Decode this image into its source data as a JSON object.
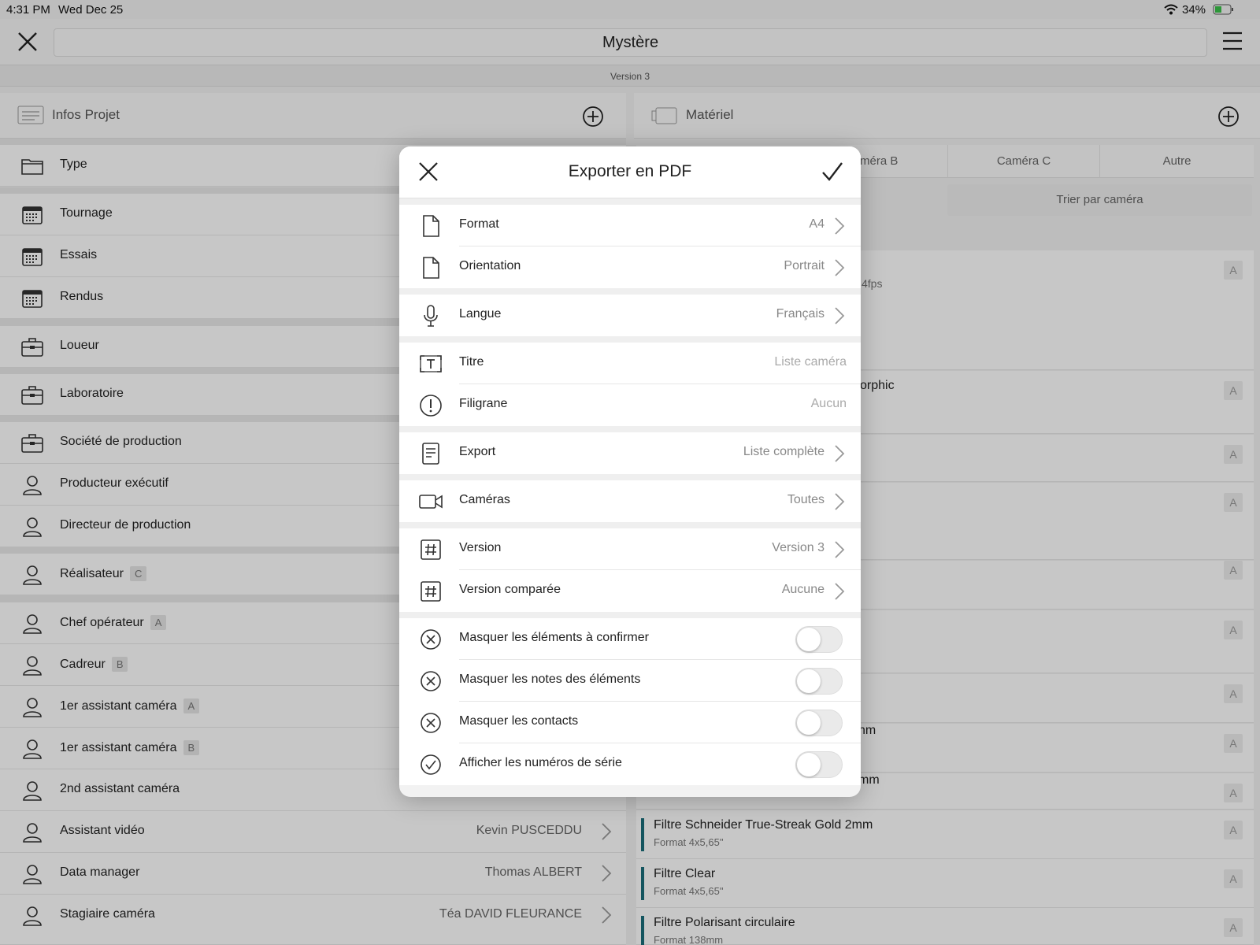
{
  "status_bar": {
    "time": "4:31 PM",
    "date": "Wed Dec 25",
    "battery": "34%"
  },
  "header": {
    "title": "Mystère",
    "version": "Version 3"
  },
  "left_panel": {
    "title": "Infos Projet",
    "rows": [
      {
        "label": "Type",
        "icon": "folder-icon"
      },
      {
        "label": "Tournage",
        "icon": "calendar-icon"
      },
      {
        "label": "Essais",
        "icon": "calendar-icon"
      },
      {
        "label": "Rendus",
        "icon": "calendar-icon"
      },
      {
        "label": "Loueur",
        "icon": "briefcase-icon"
      },
      {
        "label": "Laboratoire",
        "icon": "briefcase-icon"
      },
      {
        "label": "Société de production",
        "icon": "briefcase-icon"
      },
      {
        "label": "Producteur exécutif",
        "icon": "person-icon"
      },
      {
        "label": "Directeur de production",
        "icon": "person-icon"
      },
      {
        "label": "Réalisateur",
        "badge": "C",
        "icon": "person-icon"
      },
      {
        "label": "Chef opérateur",
        "badge": "A",
        "icon": "person-icon"
      },
      {
        "label": "Cadreur",
        "badge": "B",
        "icon": "person-icon"
      },
      {
        "label": "1er assistant caméra",
        "badge": "A",
        "icon": "person-icon"
      },
      {
        "label": "1er assistant caméra",
        "badge": "B",
        "icon": "person-icon"
      },
      {
        "label": "2nd assistant caméra",
        "icon": "person-icon"
      },
      {
        "label": "Assistant vidéo",
        "value": "Kevin PUSCEDDU",
        "icon": "person-icon"
      },
      {
        "label": "Data manager",
        "value": "Thomas ALBERT",
        "icon": "person-icon"
      },
      {
        "label": "Stagiaire caméra",
        "value": "Téa DAVID FLEURANCE",
        "icon": "person-icon"
      }
    ]
  },
  "right_panel": {
    "title": "Matériel",
    "tabs": [
      "méra B",
      "Caméra C",
      "Autre"
    ],
    "sort_button": "Trier par caméra",
    "partial_texts": [
      "4fps",
      "orphic",
      "nm",
      "mm"
    ],
    "badge": "A",
    "items": [
      {
        "title": "Filtre Schneider True-Streak Gold 2mm",
        "subtitle": "Format 4x5,65\""
      },
      {
        "title": "Filtre Clear",
        "subtitle": "Format 4x5,65\""
      },
      {
        "title": "Filtre Polarisant circulaire",
        "subtitle": "Format 138mm"
      }
    ]
  },
  "modal": {
    "title": "Exporter en PDF",
    "rows": [
      {
        "label": "Format",
        "value": "A4",
        "icon": "document-icon"
      },
      {
        "label": "Orientation",
        "value": "Portrait",
        "icon": "document-icon"
      },
      {
        "label": "Langue",
        "value": "Français",
        "icon": "microphone-icon"
      },
      {
        "label": "Titre",
        "placeholder": "Liste caméra",
        "icon": "text-box-icon"
      },
      {
        "label": "Filigrane",
        "placeholder": "Aucun",
        "icon": "exclamation-circle-icon"
      },
      {
        "label": "Export",
        "value": "Liste complète",
        "icon": "list-document-icon"
      },
      {
        "label": "Caméras",
        "value": "Toutes",
        "icon": "video-camera-icon"
      },
      {
        "label": "Version",
        "value": "Version 3",
        "icon": "hash-icon"
      },
      {
        "label": "Version comparée",
        "value": "Aucune",
        "icon": "hash-icon"
      }
    ],
    "toggles": [
      {
        "label": "Masquer les éléments à confirmer",
        "on": false,
        "icon": "x-circle-icon"
      },
      {
        "label": "Masquer les notes des éléments",
        "on": false,
        "icon": "x-circle-icon"
      },
      {
        "label": "Masquer les contacts",
        "on": false,
        "icon": "x-circle-icon"
      },
      {
        "label": "Afficher les numéros de série",
        "on": false,
        "icon": "check-circle-icon"
      }
    ]
  },
  "colors": {
    "accent_bar": "#1a6d7a"
  }
}
